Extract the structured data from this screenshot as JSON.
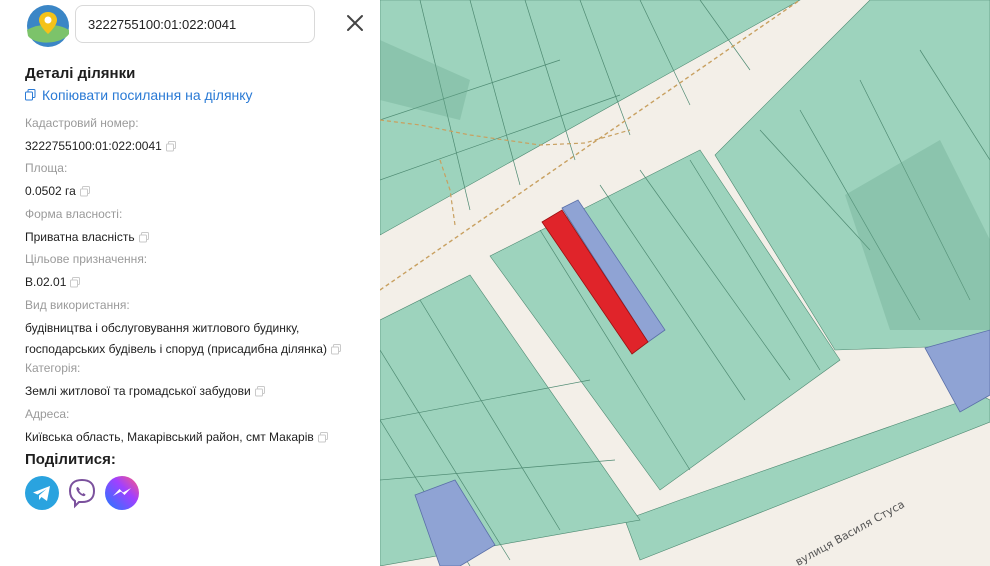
{
  "search": {
    "value": "3222755100:01:022:0041"
  },
  "details": {
    "title": "Деталі ділянки",
    "copy_link": "Копіювати посилання на ділянку"
  },
  "fields": [
    {
      "label": "Кадастровий номер:",
      "value": "3222755100:01:022:0041"
    },
    {
      "label": "Площа:",
      "value": "0.0502 га"
    },
    {
      "label": "Форма власності:",
      "value": "Приватна власність"
    },
    {
      "label": "Цільове призначення:",
      "value": "B.02.01"
    },
    {
      "label": "Вид використання:",
      "value_line1": "будівництва і обслуговування житлового будинку,",
      "value_line2": "господарських будівель і споруд (присадибна ділянка)"
    },
    {
      "label": "Категорія:",
      "value": "Землі житлової та громадської забудови"
    },
    {
      "label": "Адреса:",
      "value": "Київська область, Макарівський район, смт Макарів"
    }
  ],
  "share": {
    "title": "Поділитися:",
    "buttons": [
      "telegram-icon",
      "viber-icon",
      "messenger-icon"
    ]
  },
  "map": {
    "street_label": "вулиця Василя Стуса",
    "colors": {
      "parcel": "#9dd3bd",
      "selected": "#e0242a",
      "blue": "#8fa3d4",
      "road": "#f3efe8"
    }
  }
}
